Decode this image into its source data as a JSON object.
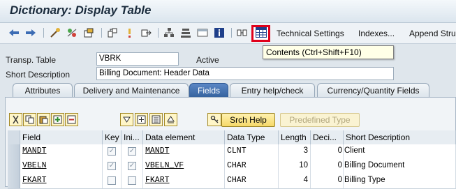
{
  "window": {
    "title": "Dictionary: Display Table"
  },
  "toolbar": {
    "icons": [
      "back-icon",
      "forward-icon",
      "other-object-icon",
      "display-change-icon",
      "activate-icon",
      "where-used-icon",
      "navigate-icon",
      "object-list-icon",
      "hierarchy-icon",
      "display-object-list-icon",
      "info-icon",
      "technical-settings-icon",
      "contents-icon"
    ],
    "technical_settings": "Technical Settings",
    "indexes": "Indexes...",
    "append_structure": "Append Stru"
  },
  "tooltip": {
    "text": "Contents   (Ctrl+Shift+F10)"
  },
  "header": {
    "transp_table_label": "Transp. Table",
    "transp_table_value": "VBRK",
    "status": "Active",
    "short_description_label": "Short Description",
    "short_description_value": "Billing Document: Header Data"
  },
  "tabs": [
    {
      "label": "Attributes",
      "active": false
    },
    {
      "label": "Delivery and Maintenance",
      "active": false
    },
    {
      "label": "Fields",
      "active": true
    },
    {
      "label": "Entry help/check",
      "active": false
    },
    {
      "label": "Currency/Quantity Fields",
      "active": false
    }
  ],
  "fields_toolbar": {
    "srch_help": "Srch Help",
    "predefined_type": "Predefined Type"
  },
  "table": {
    "columns": [
      "Field",
      "Key",
      "Ini...",
      "Data element",
      "Data Type",
      "Length",
      "Deci...",
      "Short Description"
    ],
    "rows": [
      {
        "field": "MANDT",
        "key": true,
        "initial": true,
        "data_element": "MANDT",
        "data_type": "CLNT",
        "length": "3",
        "decimals": "0",
        "short_description": "Client"
      },
      {
        "field": "VBELN",
        "key": true,
        "initial": true,
        "data_element": "VBELN_VF",
        "data_type": "CHAR",
        "length": "10",
        "decimals": "0",
        "short_description": "Billing Document"
      },
      {
        "field": "FKART",
        "key": false,
        "initial": false,
        "data_element": "FKART",
        "data_type": "CHAR",
        "length": "4",
        "decimals": "0",
        "short_description": "Billing Type"
      }
    ]
  },
  "colors": {
    "tab_active": "#36639f",
    "highlight_border": "#e0001a",
    "tooltip_bg": "#ffffe7"
  }
}
